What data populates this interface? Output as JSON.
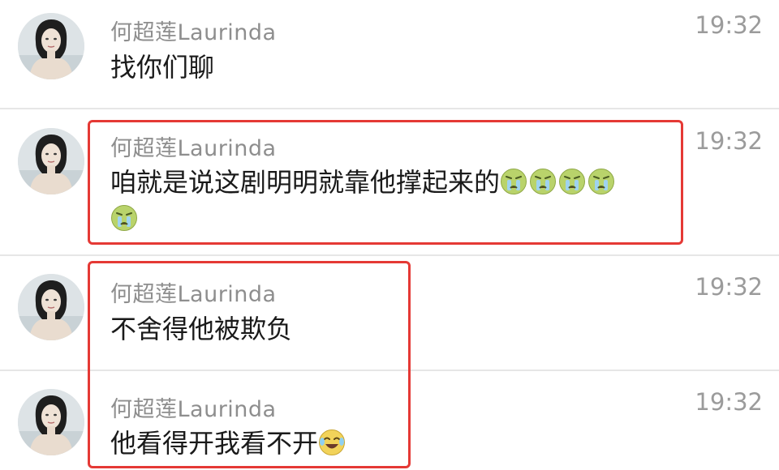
{
  "messages": [
    {
      "sender": "何超莲Laurinda",
      "time": "19:32",
      "text": "找你们聊",
      "emojis": []
    },
    {
      "sender": "何超莲Laurinda",
      "time": "19:32",
      "text": "咱就是说这剧明明就靠他撑起来的",
      "emojis": [
        "crying-face-icon",
        "crying-face-icon",
        "crying-face-icon",
        "crying-face-icon",
        "crying-face-icon"
      ]
    },
    {
      "sender": "何超莲Laurinda",
      "time": "19:32",
      "text": "不舍得他被欺负",
      "emojis": []
    },
    {
      "sender": "何超莲Laurinda",
      "time": "19:32",
      "text": "他看得开我看不开",
      "emojis": [
        "tears-of-joy-icon"
      ]
    }
  ],
  "colors": {
    "highlight": "#e53935",
    "sender": "#8e8e8e",
    "time": "#9b9b9b",
    "text": "#1a1a1a",
    "divider": "#e6e6e6"
  }
}
